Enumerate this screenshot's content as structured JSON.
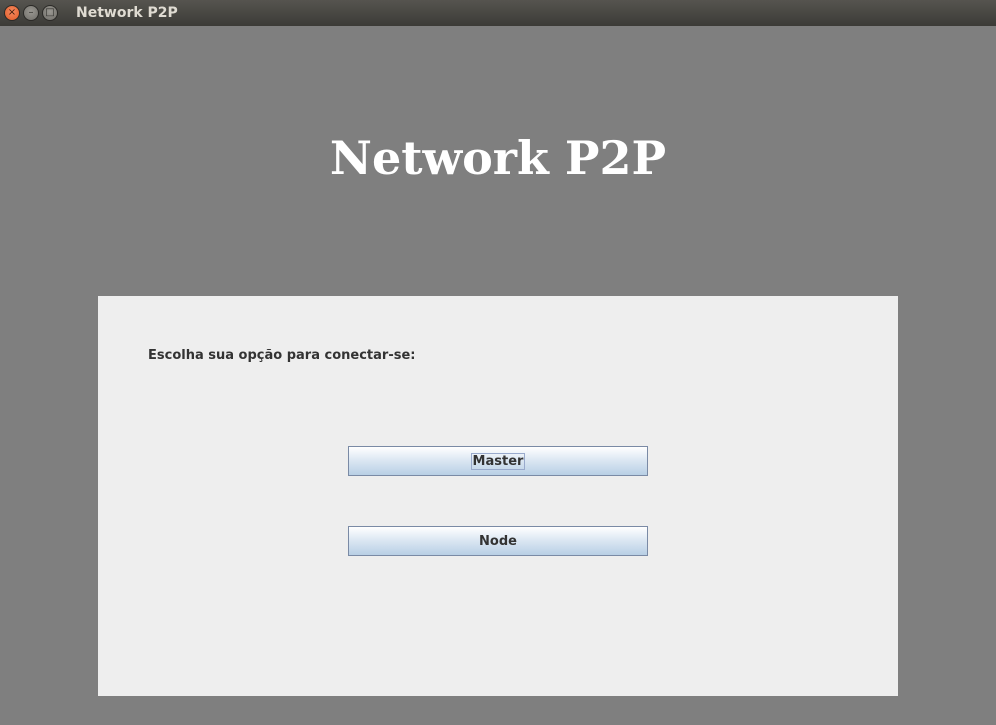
{
  "window": {
    "title": "Network P2P",
    "controls": {
      "close_glyph": "×",
      "minimize_glyph": "–",
      "maximize_glyph": "□"
    }
  },
  "main": {
    "heading": "Network P2P",
    "prompt": "Escolha sua opção para conectar-se:",
    "buttons": {
      "master_label": "Master",
      "node_label": "Node"
    }
  },
  "colors": {
    "background": "#7f7f7f",
    "panel": "#eeeeee",
    "heading_text": "#ffffff",
    "close_button": "#e05a25"
  }
}
